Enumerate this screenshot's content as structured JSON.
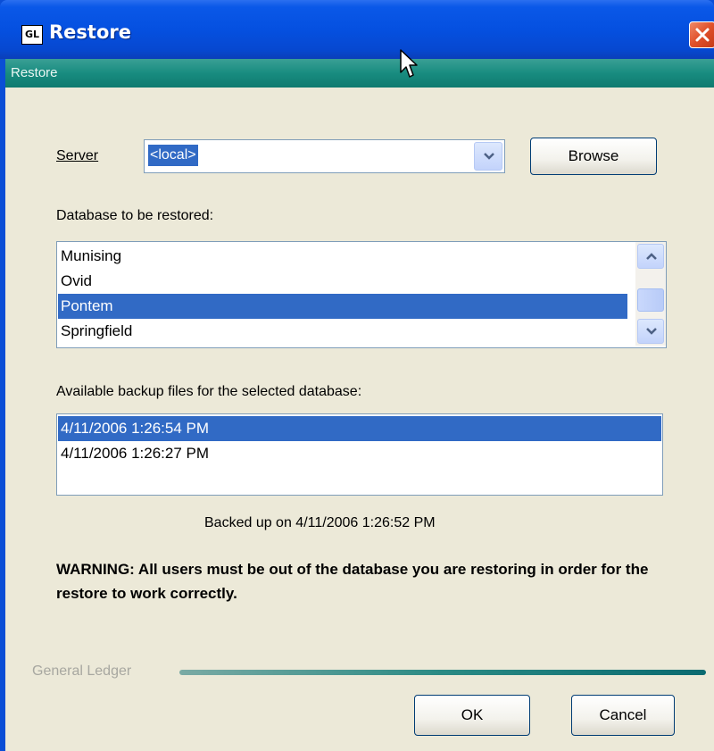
{
  "window": {
    "title": "Restore",
    "icon_text": "GL",
    "header": "Restore"
  },
  "server": {
    "label": "Server",
    "value": "<local>",
    "browse_label": "Browse"
  },
  "databases": {
    "label": "Database to be restored:",
    "items": [
      "Munising",
      "Ovid",
      "Pontem",
      "Springfield"
    ],
    "selected": "Pontem"
  },
  "backups": {
    "label": "Available backup files for the selected database:",
    "items": [
      "4/11/2006 1:26:54 PM",
      "4/11/2006 1:26:27 PM"
    ],
    "selected": "4/11/2006 1:26:54 PM"
  },
  "status": "Backed up on 4/11/2006 1:26:52 PM",
  "warning": "WARNING: All users must be out of the database you are restoring in order for the restore to work correctly.",
  "footer": {
    "label": "General Ledger"
  },
  "buttons": {
    "ok": "OK",
    "cancel": "Cancel"
  },
  "colors": {
    "title_bar": "#0550e0",
    "header_band": "#188c80",
    "selection": "#316ac5",
    "dialog_bg": "#ece9d8"
  }
}
